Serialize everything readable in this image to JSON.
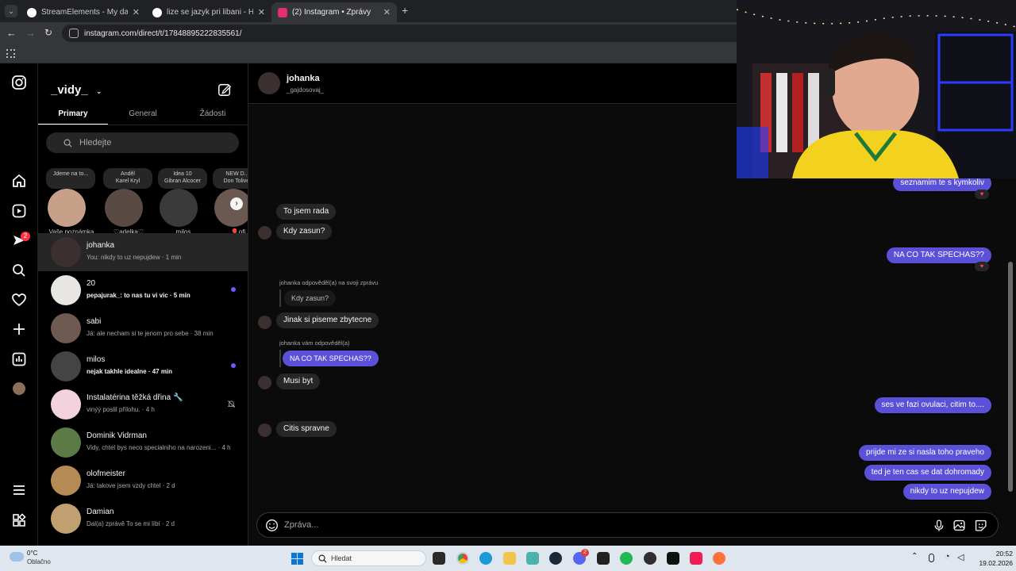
{
  "browser": {
    "tabs": [
      {
        "title": "StreamElements - My dashboard",
        "favicon_color": "#ffffff"
      },
      {
        "title": "lize se jazyk pri libani - Hledat Googlem",
        "favicon_color": "#ffffff"
      },
      {
        "title": "(2) Instagram • Zprávy",
        "favicon_color": "#e1306c"
      }
    ],
    "new_tab_symbol": "+",
    "url": "instagram.com/direct/t/17848895222835561/"
  },
  "rail": {
    "notification_badge": "2"
  },
  "inbox": {
    "username": "_vidy_",
    "tabs": [
      "Primary",
      "General",
      "Žádosti"
    ],
    "search_placeholder": "Hledejte",
    "notes": [
      {
        "note": "Jdeme na to...",
        "name": "Vaše poznámka",
        "color": "#c7a08a"
      },
      {
        "note": "Anděl\nKarel Kryl",
        "name": "♡adelka♡",
        "color": "#5a4a44"
      },
      {
        "note": "Idea 10\nGibran Alcocer",
        "name": "milos",
        "color": "#3a3a3a"
      },
      {
        "note": "NEW D...\nDon Toliver",
        "name": "🎈ofi",
        "color": "#6b5850"
      }
    ],
    "conversations": [
      {
        "name": "johanka",
        "preview": "You: nikdy to uz nepujdew · 1 min",
        "unread": false,
        "color": "#3b2f2f"
      },
      {
        "name": "20",
        "preview": "pepajurak_: to nas tu vi vic · 5 min",
        "unread": true,
        "color": "#e8e6e2"
      },
      {
        "name": "sabi",
        "preview": "Já: ale necham si te jenom pro sebe · 38 min",
        "unread": false,
        "color": "#6e5a50"
      },
      {
        "name": "milos",
        "preview": "nejak takhle idealne · 47 min",
        "unread": true,
        "color": "#444"
      },
      {
        "name": "Instalatérina těžká dřina 🔧",
        "preview": "vinýý poslil přílohu. · 4 h",
        "unread": false,
        "color": "#f2d3dd"
      },
      {
        "name": "Dominik Vidrman",
        "preview": "Vidy, chtel bys neco specialniho na narozeni... · 4 h",
        "unread": false,
        "color": "#5c7a45"
      },
      {
        "name": "olofmeister",
        "preview": "Já: takove jsem vzdy chtel · 2 d",
        "unread": false,
        "color": "#b58a55"
      },
      {
        "name": "Damian",
        "preview": "Dal(a) zprávě To se mi líbí · 2 d",
        "unread": false,
        "color": "#c0a070"
      }
    ]
  },
  "chat": {
    "contact_name": "johanka",
    "contact_handle": "_gajdosovaj_",
    "messages": [
      {
        "text": "seznamim te s kymkoliv",
        "dir": "out"
      },
      {
        "text": "To jsem rada",
        "dir": "in"
      },
      {
        "text": "Kdy zasun?",
        "dir": "in"
      },
      {
        "text": "NA CO TAK SPECHAS??",
        "dir": "out"
      },
      {
        "text": "johanka odpověděl(a) na svoji zprávu",
        "dir": "label"
      },
      {
        "text": "Kdy zasun?",
        "dir": "quote"
      },
      {
        "text": "Jinak si piseme zbytecne",
        "dir": "in"
      },
      {
        "text": "johanka vám odpověděl(a)",
        "dir": "label"
      },
      {
        "text": "NA CO TAK SPECHAS??",
        "dir": "quote-out"
      },
      {
        "text": "Musi byt",
        "dir": "in"
      },
      {
        "text": "ses ve fazi ovulaci, citim to....",
        "dir": "out"
      },
      {
        "text": "Citis spravne",
        "dir": "in"
      },
      {
        "text": "prijde mi ze si nasla toho praveho",
        "dir": "out"
      },
      {
        "text": "ted je ten cas se dat dohromady",
        "dir": "out"
      },
      {
        "text": "nikdy to uz nepujdew",
        "dir": "out"
      }
    ],
    "reaction": "♥",
    "composer_placeholder": "Zpráva..."
  },
  "taskbar": {
    "weather_temp": "0°C",
    "weather_desc": "Oblačno",
    "search_placeholder": "Hledat",
    "discord_badge": "2",
    "time": "20:52",
    "date": "19.02.2026"
  },
  "colors": {
    "accent": "#5b51d8",
    "unread_dot": "#6a5cff",
    "badge": "#ff3040"
  }
}
